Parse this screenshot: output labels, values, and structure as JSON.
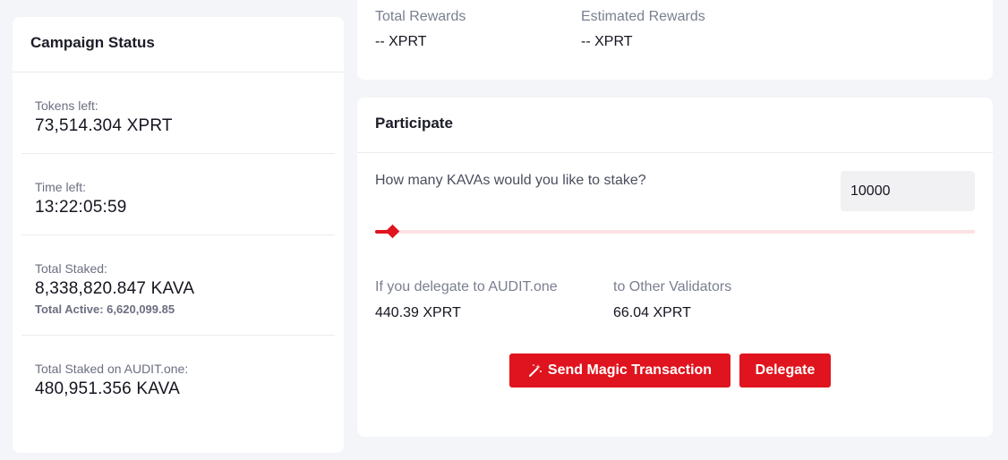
{
  "campaign": {
    "title": "Campaign Status",
    "tokens_left_label": "Tokens left:",
    "tokens_left_value": "73,514.304 XPRT",
    "time_left_label": "Time left:",
    "time_left_value": "13:22:05:59",
    "total_staked_label": "Total Staked:",
    "total_staked_value": "8,338,820.847 KAVA",
    "total_active": "Total Active: 6,620,099.85",
    "audit_staked_label": "Total Staked on AUDIT.one:",
    "audit_staked_value": "480,951.356 KAVA"
  },
  "rewards": {
    "total_label": "Total Rewards",
    "total_value": "-- XPRT",
    "estimated_label": "Estimated Rewards",
    "estimated_value": "-- XPRT"
  },
  "participate": {
    "title": "Participate",
    "question": "How many KAVAs would you like to stake?",
    "amount_value": "10000",
    "slider_fraction": 0.028,
    "audit_label": "If you delegate to AUDIT.one",
    "audit_value": "440.39 XPRT",
    "other_label": "to Other Validators",
    "other_value": "66.04 XPRT",
    "magic_button_label": "Send Magic Transaction",
    "magic_button_icon": "magic-wand-icon",
    "delegate_button_label": "Delegate"
  },
  "colors": {
    "accent": "#e0141e",
    "track": "#fbe1e3",
    "background": "#f4f5f8"
  }
}
